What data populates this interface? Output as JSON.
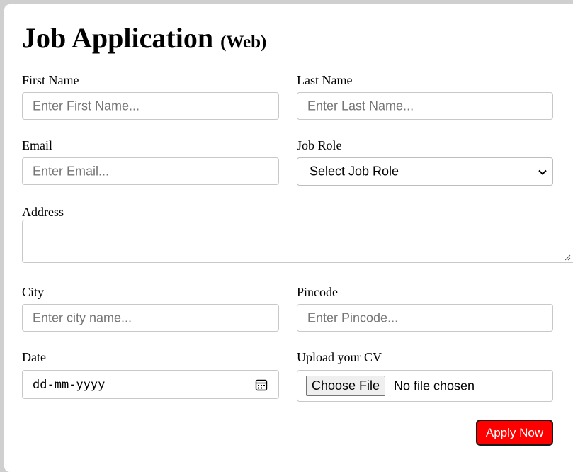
{
  "form": {
    "title": "Job Application",
    "subtitle": "(Web)",
    "first_name": {
      "label": "First Name",
      "placeholder": "Enter First Name..."
    },
    "last_name": {
      "label": "Last Name",
      "placeholder": "Enter Last Name..."
    },
    "email": {
      "label": "Email",
      "placeholder": "Enter Email..."
    },
    "job_role": {
      "label": "Job Role",
      "selected": "Select Job Role"
    },
    "address": {
      "label": "Address"
    },
    "city": {
      "label": "City",
      "placeholder": "Enter city name..."
    },
    "pincode": {
      "label": "Pincode",
      "placeholder": "Enter Pincode..."
    },
    "date": {
      "label": "Date",
      "placeholder": "dd-mm-yyyy"
    },
    "cv": {
      "label": "Upload your CV",
      "button": "Choose File",
      "status": "No file chosen"
    },
    "submit_label": "Apply Now"
  },
  "colors": {
    "page_bg": "#cfcfcf",
    "card_bg": "#ffffff",
    "submit_bg": "#ff0000",
    "submit_text": "#ffffff",
    "placeholder_text": "#757575"
  },
  "icons": {
    "job_role_dropdown": "chevron-down-icon",
    "date_picker": "calendar-icon",
    "address_resize": "resize-handle-icon"
  }
}
